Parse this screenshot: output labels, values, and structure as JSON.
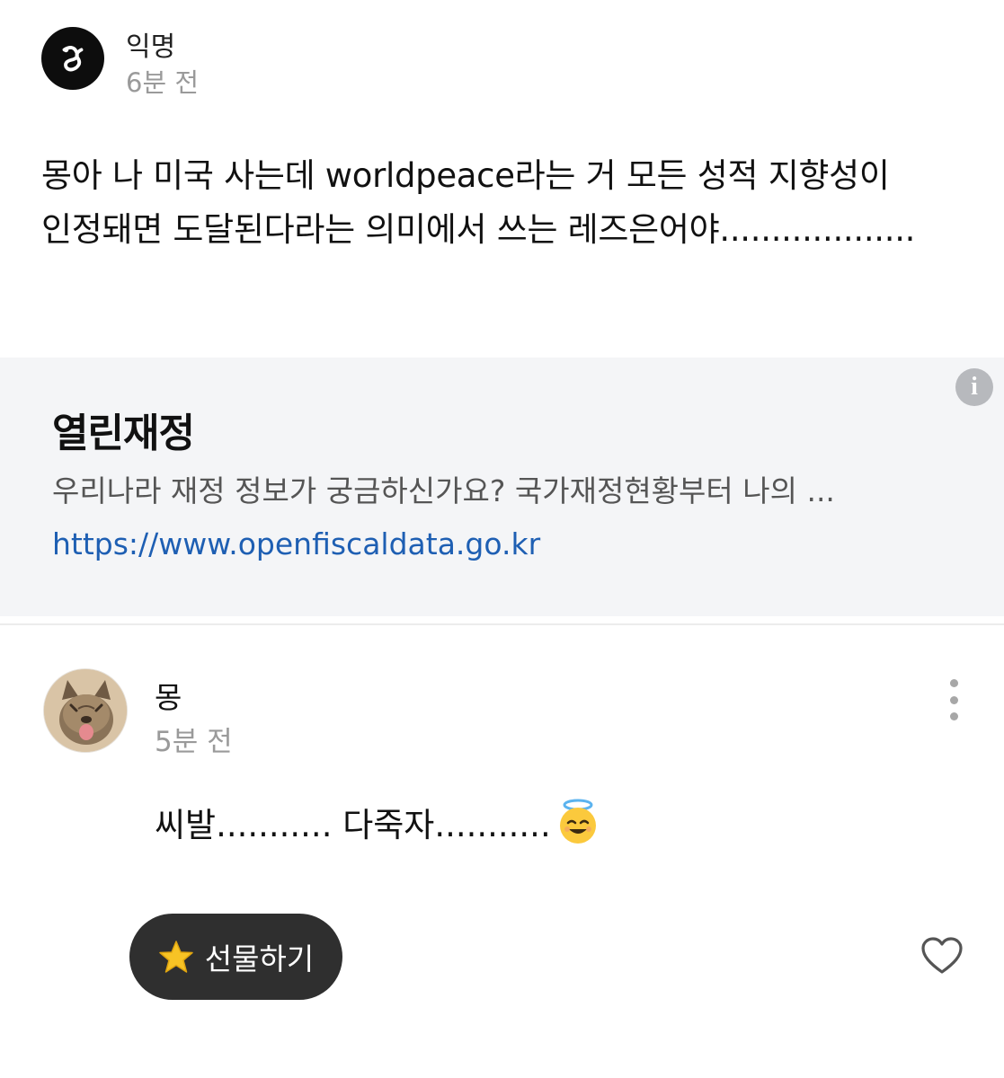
{
  "post": {
    "author": "익명",
    "time": "6분 전",
    "body_line1": "몽아 나 미국 사는데 worldpeace라는 거 모든 성적 지향성이",
    "body_line2": "인정돼면 도달된다라는 의미에서 쓰는 레즈은어야...................",
    "avatar_icon": "anonymous-logo-icon"
  },
  "link_card": {
    "title": "열린재정",
    "description": "우리나라 재정 정보가 궁금하신가요? 국가재정현황부터 나의 ...",
    "url": "https://www.openfiscaldata.go.kr",
    "info_icon": "info-icon"
  },
  "comment": {
    "author": "몽",
    "time": "5분 전",
    "body": "씨발........... 다죽자...........",
    "emoji": "smiling-face-with-halo-emoji",
    "avatar_icon": "cat-photo-avatar"
  },
  "actions": {
    "gift_label": "선물하기",
    "gift_icon": "star-icon",
    "like_icon": "heart-outline-icon",
    "more_icon": "more-vertical-icon"
  },
  "colors": {
    "link": "#1e5fb3",
    "card_bg": "#f4f5f7",
    "gift_button_bg": "#2f2f2f",
    "muted_text": "#9a9a9a"
  }
}
